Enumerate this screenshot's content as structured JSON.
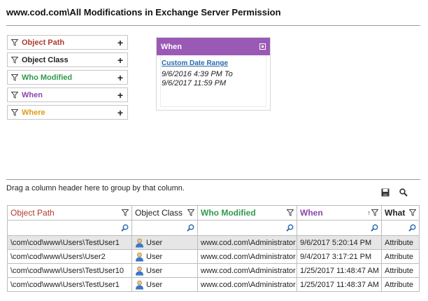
{
  "page": {
    "title": "www.cod.com\\All Modifications in Exchange Server Permission"
  },
  "filters": [
    {
      "label": "Object Path",
      "color": "#b03a2e"
    },
    {
      "label": "Object Class",
      "color": "#222222"
    },
    {
      "label": "Who Modified",
      "color": "#2e9a4a"
    },
    {
      "label": "When",
      "color": "#8e44ad"
    },
    {
      "label": "Where",
      "color": "#e09a1a"
    }
  ],
  "when_panel": {
    "title": "When",
    "header_color": "#9b59b6",
    "link": "Custom Date Range",
    "range_line1": "9/6/2016 4:39 PM To",
    "range_line2": "9/6/2017 11:59 PM"
  },
  "grid": {
    "group_hint": "Drag a column header here to group by that column.",
    "columns": [
      {
        "label": "Object Path",
        "color": "#b03a2e"
      },
      {
        "label": "Object Class",
        "color": "#222222"
      },
      {
        "label": "Who Modified",
        "color": "#2e9a4a"
      },
      {
        "label": "When",
        "color": "#8e44ad"
      },
      {
        "label": "What",
        "color": "#222222"
      }
    ],
    "rows": [
      {
        "path": "\\com\\cod\\www\\Users\\TestUser1",
        "class": "User",
        "who": "www.cod.com\\Administrator",
        "when": "9/6/2017 5:20:14 PM",
        "what": "Attribute"
      },
      {
        "path": "\\com\\cod\\www\\Users\\User2",
        "class": "User",
        "who": "www.cod.com\\Administrator",
        "when": "9/4/2017 3:17:21 PM",
        "what": "Attribute"
      },
      {
        "path": "\\com\\cod\\www\\Users\\TestUser10",
        "class": "User",
        "who": "www.cod.com\\Administrator",
        "when": "1/25/2017 11:48:47 AM",
        "what": "Attribute"
      },
      {
        "path": "\\com\\cod\\www\\Users\\TestUser1",
        "class": "User",
        "who": "www.cod.com\\Administrator",
        "when": "1/25/2017 11:48:37 AM",
        "what": "Attribute"
      }
    ]
  }
}
